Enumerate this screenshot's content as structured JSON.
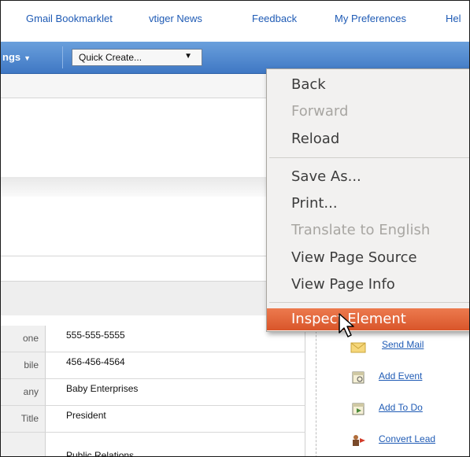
{
  "top_links": [
    "Gmail Bookmarklet",
    "vtiger News",
    "Feedback",
    "My Preferences",
    "Hel"
  ],
  "toolbar": {
    "settings_label": "ngs",
    "quick_create_label": "Quick Create..."
  },
  "details": [
    {
      "label": "one",
      "value": "555-555-5555"
    },
    {
      "label": "bile",
      "value": "456-456-4564"
    },
    {
      "label": "any",
      "value": "Baby Enterprises"
    },
    {
      "label": "Title",
      "value": "President"
    },
    {
      "label": "",
      "value": "Public Relations"
    }
  ],
  "actions": [
    "Send Mail",
    "Add Event",
    "Add To Do",
    "Convert Lead"
  ],
  "context_menu": {
    "back": "Back",
    "forward": "Forward",
    "reload": "Reload",
    "save_as": "Save As...",
    "print": "Print...",
    "translate": "Translate to English",
    "view_source": "View Page Source",
    "view_info": "View Page Info",
    "inspect": "Inspect Element"
  },
  "colors": {
    "link": "#1f5bb5",
    "toolbar": "#4f86cc",
    "menu_highlight": "#e0643a"
  }
}
